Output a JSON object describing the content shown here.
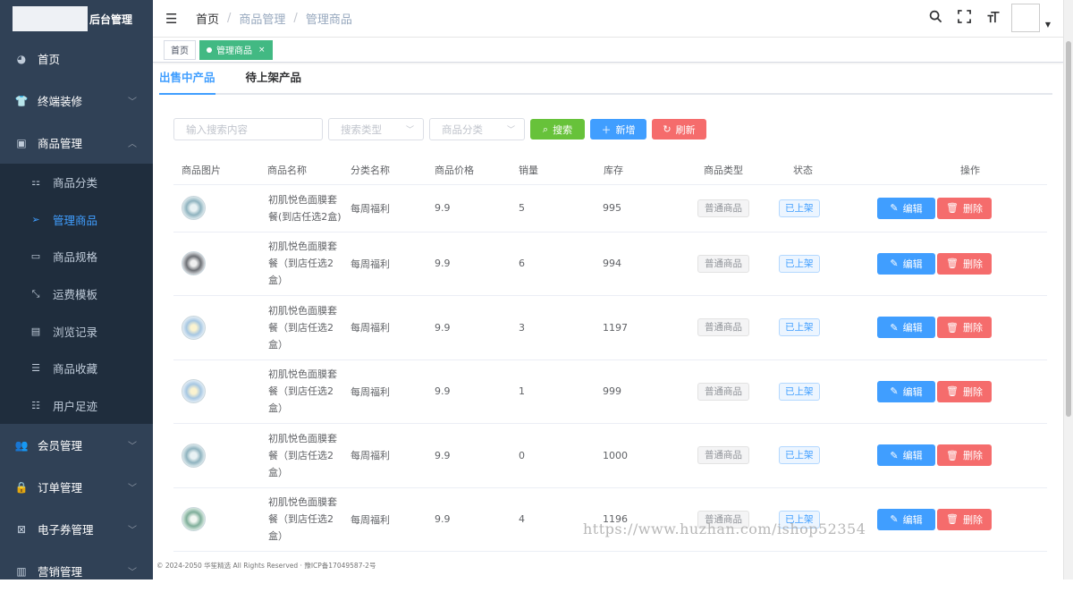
{
  "app": {
    "title": "后台管理"
  },
  "sidebar": {
    "items": [
      {
        "label": "首页",
        "icon": "dashboard-icon"
      },
      {
        "label": "终端装修",
        "icon": "shirt-icon"
      },
      {
        "label": "商品管理",
        "icon": "monitor-icon"
      },
      {
        "label": "会员管理",
        "icon": "users-icon"
      },
      {
        "label": "订单管理",
        "icon": "lock-icon"
      },
      {
        "label": "电子券管理",
        "icon": "coupon-icon"
      },
      {
        "label": "营销管理",
        "icon": "chart-icon"
      }
    ],
    "subitems": [
      {
        "label": "商品分类",
        "icon": "grid-icon"
      },
      {
        "label": "管理商品",
        "icon": "send-icon"
      },
      {
        "label": "商品规格",
        "icon": "screen-icon"
      },
      {
        "label": "运费模板",
        "icon": "shrink-icon"
      },
      {
        "label": "浏览记录",
        "icon": "document-icon"
      },
      {
        "label": "商品收藏",
        "icon": "menu-icon"
      },
      {
        "label": "用户足迹",
        "icon": "list-icon"
      }
    ]
  },
  "breadcrumb": {
    "home": "首页",
    "parent": "商品管理",
    "current": "管理商品"
  },
  "tags": {
    "home": "首页",
    "current": "管理商品"
  },
  "tabs": {
    "on_sale": "出售中产品",
    "pending": "待上架产品"
  },
  "filters": {
    "search_placeholder": "输入搜索内容",
    "type_placeholder": "搜索类型",
    "category_placeholder": "商品分类",
    "search_btn": "搜索",
    "add_btn": "新增",
    "refresh_btn": "刷新"
  },
  "table": {
    "headers": [
      "商品图片",
      "商品名称",
      "分类名称",
      "商品价格",
      "销量",
      "库存",
      "商品类型",
      "状态",
      "操作"
    ],
    "rows": [
      {
        "name": "初肌悦色面膜套餐(到店任选2盒)",
        "category": "每周福利",
        "price": "9.9",
        "sales": "5",
        "stock": "995",
        "type": "普通商品",
        "status": "已上架"
      },
      {
        "name": "初肌悦色面膜套餐（到店任选2盒）",
        "category": "每周福利",
        "price": "9.9",
        "sales": "6",
        "stock": "994",
        "type": "普通商品",
        "status": "已上架"
      },
      {
        "name": "初肌悦色面膜套餐（到店任选2盒）",
        "category": "每周福利",
        "price": "9.9",
        "sales": "3",
        "stock": "1197",
        "type": "普通商品",
        "status": "已上架"
      },
      {
        "name": "初肌悦色面膜套餐（到店任选2盒）",
        "category": "每周福利",
        "price": "9.9",
        "sales": "1",
        "stock": "999",
        "type": "普通商品",
        "status": "已上架"
      },
      {
        "name": "初肌悦色面膜套餐（到店任选2盒）",
        "category": "每周福利",
        "price": "9.9",
        "sales": "0",
        "stock": "1000",
        "type": "普通商品",
        "status": "已上架"
      },
      {
        "name": "初肌悦色面膜套餐（到店任选2盒）",
        "category": "每周福利",
        "price": "9.9",
        "sales": "4",
        "stock": "1196",
        "type": "普通商品",
        "status": "已上架"
      }
    ],
    "edit_label": "编辑",
    "delete_label": "删除"
  },
  "footer": "© 2024-2050 华笙精选 All Rights Reserved · 豫ICP备17049587-2号",
  "watermark": "https://www.huzhan.com/ishop52354",
  "colors": {
    "sidebar_bg": "#304156",
    "accent": "#409eff",
    "success": "#67c23a",
    "danger": "#f56c6c",
    "tag_active": "#42b983"
  }
}
